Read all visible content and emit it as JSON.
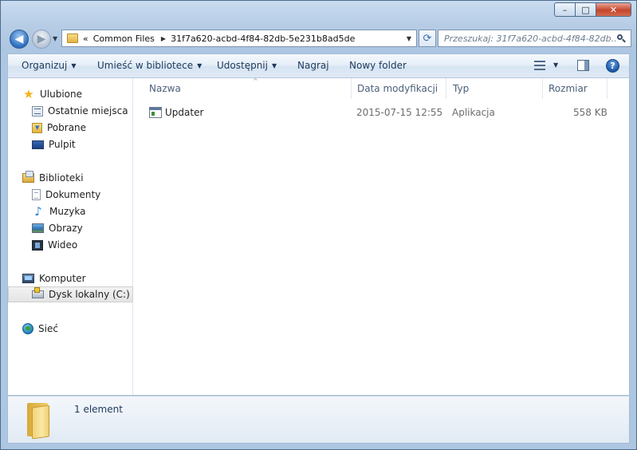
{
  "window": {
    "controls": {
      "minimize": "–",
      "maximize": "□",
      "close": "✕"
    }
  },
  "address": {
    "chevrons": "«",
    "crumbs": [
      "Common Files",
      "31f7a620-acbd-4f84-82db-5e231b8ad5de"
    ],
    "separator": "▶"
  },
  "search": {
    "placeholder": "Przeszukaj: 31f7a620-acbd-4f84-82db..."
  },
  "toolbar": {
    "organize": "Organizuj",
    "include_library": "Umieść w bibliotece",
    "share": "Udostępnij",
    "burn": "Nagraj",
    "new_folder": "Nowy folder",
    "help": "?"
  },
  "sidebar": {
    "favorites": {
      "label": "Ulubione",
      "items": [
        "Ostatnie miejsca",
        "Pobrane",
        "Pulpit"
      ]
    },
    "libraries": {
      "label": "Biblioteki",
      "items": [
        "Dokumenty",
        "Muzyka",
        "Obrazy",
        "Wideo"
      ]
    },
    "computer": {
      "label": "Komputer",
      "items": [
        "Dysk lokalny (C:)"
      ]
    },
    "network": {
      "label": "Sieć"
    }
  },
  "columns": {
    "name": "Nazwa",
    "modified": "Data modyfikacji",
    "type": "Typ",
    "size": "Rozmiar"
  },
  "files": [
    {
      "name": "Updater",
      "modified": "2015-07-15 12:55",
      "type": "Aplikacja",
      "size": "558 KB",
      "icon": "application-icon"
    }
  ],
  "status": {
    "count_text": "1 element"
  }
}
